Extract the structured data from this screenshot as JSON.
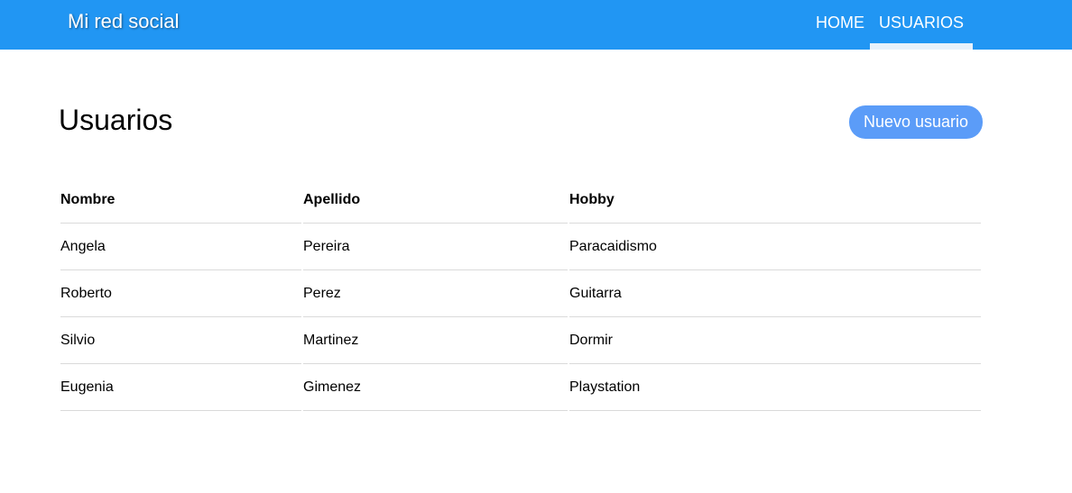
{
  "navbar": {
    "brand": "Mi red social",
    "items": [
      {
        "label": "HOME",
        "active": false
      },
      {
        "label": "USUARIOS",
        "active": true
      }
    ],
    "color": "#2196f3"
  },
  "main": {
    "title": "Usuarios",
    "new_button_label": "Nuevo usuario",
    "table": {
      "headers": [
        "Nombre",
        "Apellido",
        "Hobby"
      ],
      "rows": [
        [
          "Angela",
          "Pereira",
          "Paracaidismo"
        ],
        [
          "Roberto",
          "Perez",
          "Guitarra"
        ],
        [
          "Silvio",
          "Martinez",
          "Dormir"
        ],
        [
          "Eugenia",
          "Gimenez",
          "Playstation"
        ]
      ]
    }
  }
}
